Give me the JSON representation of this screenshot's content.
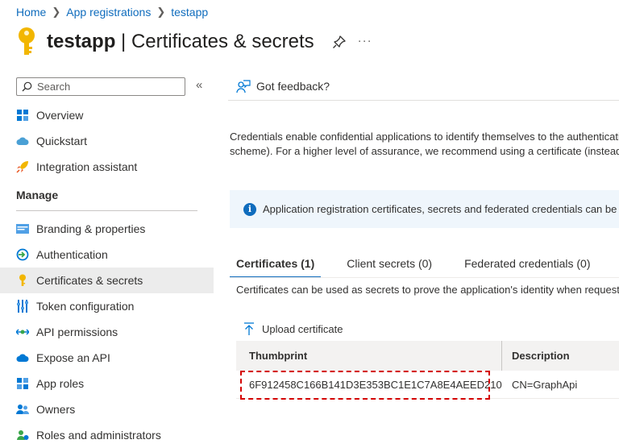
{
  "breadcrumb": {
    "home": "Home",
    "app_registrations": "App registrations",
    "current": "testapp"
  },
  "header": {
    "app_name": "testapp",
    "separator": " | ",
    "page_name": "Certificates & secrets",
    "more": "···"
  },
  "search": {
    "placeholder": "Search"
  },
  "nav": {
    "overview": "Overview",
    "quickstart": "Quickstart",
    "integration_assistant": "Integration assistant",
    "manage_section": "Manage",
    "branding": "Branding & properties",
    "authentication": "Authentication",
    "certificates": "Certificates & secrets",
    "token_configuration": "Token configuration",
    "api_permissions": "API permissions",
    "expose_api": "Expose an API",
    "app_roles": "App roles",
    "owners": "Owners",
    "roles_admins": "Roles and administrators"
  },
  "feedback": {
    "label": "Got feedback?"
  },
  "description": {
    "line1": "Credentials enable confidential applications to identify themselves to the authentication service when receiving tokens at a web addressable location (using an HTTPS",
    "line2": "scheme). For a higher level of assurance, we recommend using a certificate (instead of a client secret) as a credential."
  },
  "info_bar": {
    "text": "Application registration certificates, secrets and federated credentials can be found in the tabs below."
  },
  "tabs": [
    {
      "label": "Certificates (1)",
      "active": true
    },
    {
      "label": "Client secrets (0)",
      "active": false
    },
    {
      "label": "Federated credentials (0)",
      "active": false
    }
  ],
  "tab_description": "Certificates can be used as secrets to prove the application's identity when requesting a token. Also can be referred to as public keys.",
  "upload": {
    "label": "Upload certificate"
  },
  "table": {
    "columns": [
      "Thumbprint",
      "Description"
    ],
    "rows": [
      {
        "thumbprint": "6F912458C166B141D3E353BC1E1C7A8E4AEED210",
        "description": "CN=GraphApi"
      }
    ]
  },
  "colors": {
    "accent": "#0f6cbd",
    "highlight": "#d40000",
    "key_icon": "#f2b600"
  }
}
